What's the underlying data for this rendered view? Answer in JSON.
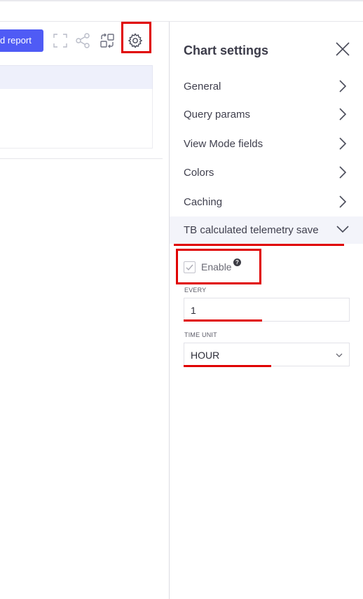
{
  "toolbar": {
    "report_button_label": "d report",
    "icons": [
      "fullscreen-icon",
      "share-icon",
      "swap-icon",
      "gear-icon"
    ]
  },
  "chart_settings": {
    "title": "Chart settings",
    "sections": [
      {
        "label": "General",
        "expanded": false
      },
      {
        "label": "Query params",
        "expanded": false
      },
      {
        "label": "View Mode fields",
        "expanded": false
      },
      {
        "label": "Colors",
        "expanded": false
      },
      {
        "label": "Caching",
        "expanded": false
      },
      {
        "label": "TB calculated telemetry save",
        "expanded": true
      }
    ],
    "telemetry_save": {
      "enable_label": "Enable",
      "enable_checked": true,
      "help_glyph": "?",
      "every_label": "EVERY",
      "every_value": "1",
      "time_unit_label": "TIME UNIT",
      "time_unit_value": "HOUR"
    }
  },
  "colors": {
    "accent": "#4f5bf5",
    "highlight": "#e00000",
    "active_row_bg": "#f3f4fa"
  }
}
